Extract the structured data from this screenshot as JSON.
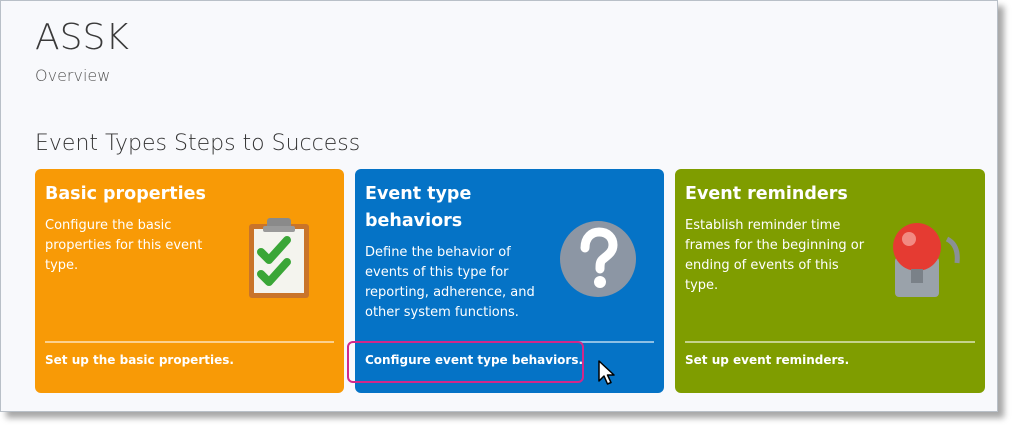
{
  "header": {
    "title": "ASSK",
    "subtitle": "Overview"
  },
  "section": {
    "title": "Event Types Steps to Success"
  },
  "cards": [
    {
      "heading": "Basic properties",
      "description": "Configure the basic properties for this event type.",
      "action": "Set up the basic properties.",
      "icon": "clipboard-checklist-icon",
      "color": "#f89a06"
    },
    {
      "heading": "Event type behaviors",
      "description": "Define the behavior of events of this type for reporting, adherence, and other system functions.",
      "action": "Configure event type behaviors.",
      "icon": "question-mark-icon",
      "color": "#0573c6"
    },
    {
      "heading": "Event reminders",
      "description": "Establish reminder time frames for the beginning or ending of events of this type.",
      "action": "Set up event reminders.",
      "icon": "alarm-bell-icon",
      "color": "#7f9d00"
    }
  ],
  "colors": {
    "highlight": "#d1288a"
  }
}
